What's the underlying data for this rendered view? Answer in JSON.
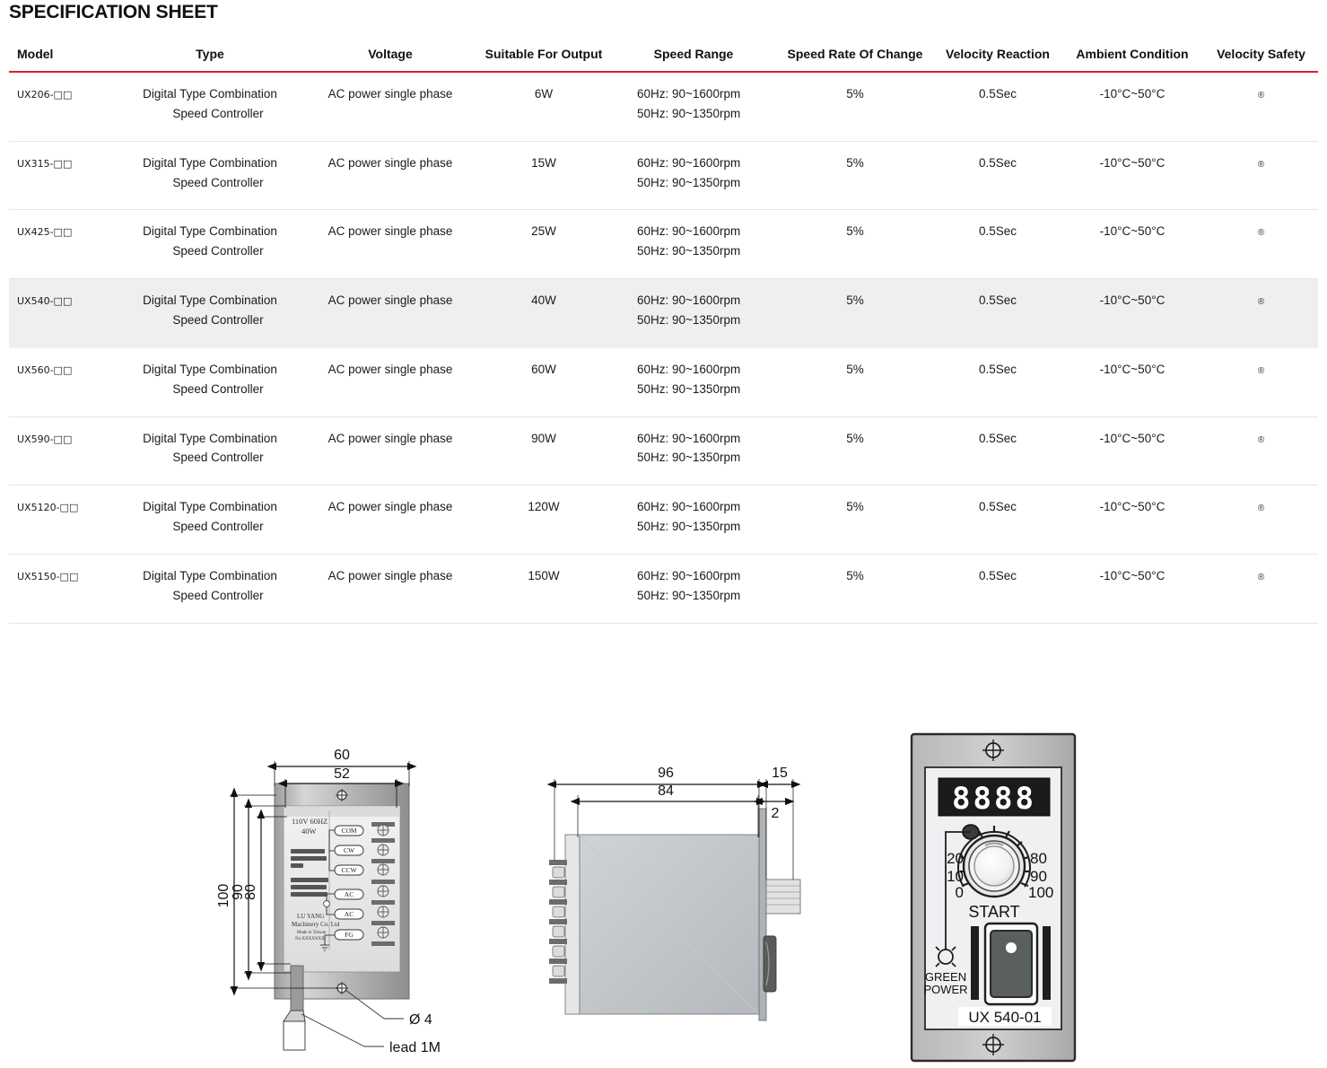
{
  "document": {
    "title": "SPECIFICATION SHEET"
  },
  "table": {
    "headers": [
      "Model",
      "Type",
      "Voltage",
      "Suitable For Output",
      "Speed Range",
      "Speed Rate Of Change",
      "Velocity Reaction",
      "Ambient Condition",
      "Velocity Safety"
    ],
    "accent_color": "#d8202f",
    "highlight_row_index": 3,
    "highlight_color": "#efefef",
    "rows": [
      {
        "model": "UX206-□□",
        "type_line1": "Digital Type Combination",
        "type_line2": "Speed Controller",
        "voltage": "AC power single phase",
        "output": "6W",
        "speed_60hz": "60Hz: 90~1600rpm",
        "speed_50hz": "50Hz: 90~1350rpm",
        "rate_of_change": "5%",
        "velocity_reaction": "0.5Sec",
        "ambient": "-10°C~50°C",
        "velocity_safety": "®"
      },
      {
        "model": "UX315-□□",
        "type_line1": "Digital Type Combination",
        "type_line2": "Speed Controller",
        "voltage": "AC power single phase",
        "output": "15W",
        "speed_60hz": "60Hz: 90~1600rpm",
        "speed_50hz": "50Hz: 90~1350rpm",
        "rate_of_change": "5%",
        "velocity_reaction": "0.5Sec",
        "ambient": "-10°C~50°C",
        "velocity_safety": "®"
      },
      {
        "model": "UX425-□□",
        "type_line1": "Digital Type Combination",
        "type_line2": "Speed Controller",
        "voltage": "AC power single phase",
        "output": "25W",
        "speed_60hz": "60Hz: 90~1600rpm",
        "speed_50hz": "50Hz: 90~1350rpm",
        "rate_of_change": "5%",
        "velocity_reaction": "0.5Sec",
        "ambient": "-10°C~50°C",
        "velocity_safety": "®"
      },
      {
        "model": "UX540-□□",
        "type_line1": "Digital Type Combination",
        "type_line2": "Speed Controller",
        "voltage": "AC power single phase",
        "output": "40W",
        "speed_60hz": "60Hz: 90~1600rpm",
        "speed_50hz": "50Hz: 90~1350rpm",
        "rate_of_change": "5%",
        "velocity_reaction": "0.5Sec",
        "ambient": "-10°C~50°C",
        "velocity_safety": "®"
      },
      {
        "model": "UX560-□□",
        "type_line1": "Digital Type Combination",
        "type_line2": "Speed Controller",
        "voltage": "AC power single phase",
        "output": "60W",
        "speed_60hz": "60Hz: 90~1600rpm",
        "speed_50hz": "50Hz: 90~1350rpm",
        "rate_of_change": "5%",
        "velocity_reaction": "0.5Sec",
        "ambient": "-10°C~50°C",
        "velocity_safety": "®"
      },
      {
        "model": "UX590-□□",
        "type_line1": "Digital Type Combination",
        "type_line2": "Speed Controller",
        "voltage": "AC power single phase",
        "output": "90W",
        "speed_60hz": "60Hz: 90~1600rpm",
        "speed_50hz": "50Hz: 90~1350rpm",
        "rate_of_change": "5%",
        "velocity_reaction": "0.5Sec",
        "ambient": "-10°C~50°C",
        "velocity_safety": "®"
      },
      {
        "model": "UX5120-□□",
        "type_line1": "Digital Type Combination",
        "type_line2": "Speed Controller",
        "voltage": "AC power single phase",
        "output": "120W",
        "speed_60hz": "60Hz: 90~1600rpm",
        "speed_50hz": "50Hz: 90~1350rpm",
        "rate_of_change": "5%",
        "velocity_reaction": "0.5Sec",
        "ambient": "-10°C~50°C",
        "velocity_safety": "®"
      },
      {
        "model": "UX5150-□□",
        "type_line1": "Digital Type Combination",
        "type_line2": "Speed Controller",
        "voltage": "AC power single phase",
        "output": "150W",
        "speed_60hz": "60Hz: 90~1600rpm",
        "speed_50hz": "50Hz: 90~1350rpm",
        "rate_of_change": "5%",
        "velocity_reaction": "0.5Sec",
        "ambient": "-10°C~50°C",
        "velocity_safety": "®"
      }
    ]
  },
  "drawings": {
    "front_view": {
      "dim_width_outer": "60",
      "dim_width_inner": "52",
      "dim_height_outer": "100",
      "dim_height_mid": "90",
      "dim_height_inner": "80",
      "callout_hole": "Ø 4",
      "callout_lead": "lead 1M",
      "label_voltage": "110V 60HZ",
      "label_watt": "40W",
      "label_brand_line1": "LU YANG",
      "label_brand_line2": "Machinery Co. Ltd",
      "label_brand_line3": "Made in Taiwan",
      "label_brand_line4": "No.XXXXXXX",
      "terminals": [
        "COM",
        "CW",
        "CCW",
        "AC",
        "AC",
        "FG"
      ]
    },
    "side_view": {
      "dim_depth_outer": "96",
      "dim_depth_inner": "84",
      "dim_front_depth": "15",
      "dim_panel_thickness": "2"
    },
    "panel_view": {
      "display_digits": "8888",
      "dial_labels_left": [
        "20",
        "10",
        "0"
      ],
      "dial_labels_right": [
        "80",
        "90",
        "100"
      ],
      "start_label": "START",
      "led_label_line1": "GREEN",
      "led_label_line2": "POWER",
      "model_plate": "UX 540-01"
    }
  }
}
